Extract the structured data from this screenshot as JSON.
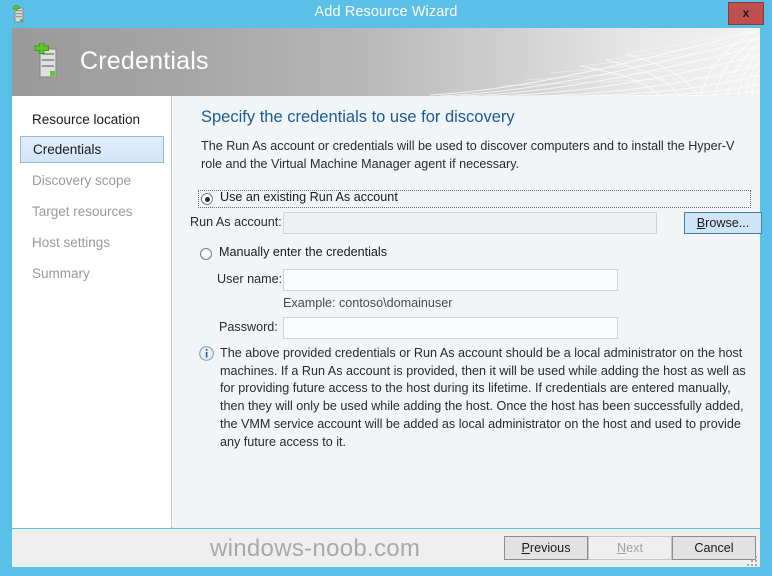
{
  "window": {
    "title": "Add Resource Wizard",
    "icon": "server-add-icon",
    "close_label": "x",
    "accent_color": "#5bc0e8",
    "close_color": "#c0504d"
  },
  "banner": {
    "title": "Credentials",
    "icon": "server-add-icon"
  },
  "sidebar": {
    "items": [
      {
        "label": "Resource location",
        "state": "done"
      },
      {
        "label": "Credentials",
        "state": "active"
      },
      {
        "label": "Discovery scope",
        "state": "pending"
      },
      {
        "label": "Target resources",
        "state": "pending"
      },
      {
        "label": "Host settings",
        "state": "pending"
      },
      {
        "label": "Summary",
        "state": "pending"
      }
    ]
  },
  "main": {
    "heading": "Specify the credentials to use for discovery",
    "description": "The Run As account or credentials will be used to discover computers and to install the Hyper-V role and the Virtual Machine Manager agent if necessary.",
    "option_existing": {
      "label": "Use an existing Run As account",
      "selected": true,
      "runas_label": "Run As account:",
      "runas_value": "",
      "runas_placeholder": "",
      "browse_label": "Browse..."
    },
    "option_manual": {
      "label": "Manually enter the credentials",
      "selected": false,
      "username_label": "User name:",
      "username_value": "",
      "username_placeholder": "",
      "example_text": "Example: contoso\\domainuser",
      "password_label": "Password:",
      "password_value": "",
      "password_placeholder": ""
    },
    "info": {
      "icon": "info-icon",
      "text": "The above provided credentials or Run As account should be a local administrator on the host machines. If a Run As account is provided, then it will be used while adding the host as well as for providing future access to the host during its lifetime. If credentials are entered manually, then they will only be used while adding the host. Once the host has been successfully added, the VMM service account will be added as local administrator on the host and used to provide any future access to it."
    }
  },
  "footer": {
    "watermark": "windows-noob.com",
    "previous_label": "Previous",
    "next_label": "Next",
    "cancel_label": "Cancel",
    "next_enabled": false
  }
}
